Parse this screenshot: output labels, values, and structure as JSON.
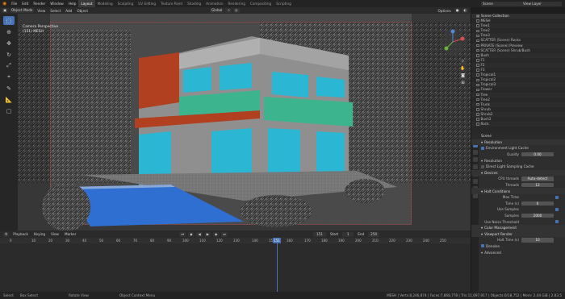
{
  "app": {
    "menus": [
      "File",
      "Edit",
      "Render",
      "Window",
      "Help"
    ],
    "workspaces": [
      "Layout",
      "Modeling",
      "Sculpting",
      "UV Editing",
      "Texture Paint",
      "Shading",
      "Animation",
      "Rendering",
      "Compositing",
      "Scripting"
    ],
    "active_workspace": "Layout",
    "scene": "Scene",
    "view_layer": "View Layer"
  },
  "viewport_header": {
    "mode": "Object Mode",
    "menus": [
      "View",
      "Select",
      "Add",
      "Object"
    ],
    "transform": "Global",
    "options": "Options"
  },
  "viewport": {
    "camera_label": "Camera Perspective",
    "object_label": "(151) MESH"
  },
  "timeline": {
    "menus": [
      "Playback",
      "Keying",
      "View",
      "Marker"
    ],
    "current_frame": "151",
    "start_label": "Start",
    "start": "1",
    "end_label": "End",
    "end": "250",
    "ruler": [
      "0",
      "10",
      "20",
      "30",
      "40",
      "50",
      "60",
      "70",
      "80",
      "90",
      "100",
      "110",
      "120",
      "130",
      "140",
      "150",
      "160",
      "170",
      "180",
      "190",
      "200",
      "210",
      "220",
      "230",
      "240",
      "250"
    ]
  },
  "outliner": {
    "title": "Scene Collection",
    "items": [
      "MESH",
      "Tree1",
      "Tree2",
      "Tree3",
      "SCATTER (Scene) Rocks",
      "PRIVATE (Scene) Preview",
      "SCATTER (Scene) Shrub/Bush",
      "Bush",
      "F1",
      "F2",
      "F3",
      "Tropical1",
      "Tropical2",
      "Tropical3",
      "Flower",
      "Tree",
      "Tree2",
      "Trunk",
      "Shrub",
      "Shrub2",
      "Bush2",
      "Rock"
    ]
  },
  "properties": {
    "header": "Scene",
    "rows": [
      {
        "type": "section",
        "label": "Resolution"
      },
      {
        "type": "check",
        "label": "Environment Light Cache",
        "on": true
      },
      {
        "type": "field",
        "label": "Quality",
        "value": "0.00"
      },
      {
        "type": "sub",
        "label": "Resolution"
      },
      {
        "type": "check",
        "label": "Direct Light Sampling Cache",
        "on": false
      },
      {
        "type": "section",
        "label": "Devices"
      },
      {
        "type": "field",
        "label": "CPU threads",
        "value": "Auto-detect"
      },
      {
        "type": "field",
        "label": "Threads",
        "value": "12"
      },
      {
        "type": "section",
        "label": "Halt Conditions"
      },
      {
        "type": "right",
        "label": "Max Time"
      },
      {
        "type": "field",
        "label": "Time (s)",
        "value": "0"
      },
      {
        "type": "right",
        "label": "Use Samples"
      },
      {
        "type": "field",
        "label": "Samples",
        "value": "2000"
      },
      {
        "type": "right",
        "label": "Use Noise Threshold"
      },
      {
        "type": "section",
        "label": "Color Management"
      },
      {
        "type": "section",
        "label": "Viewport Render"
      },
      {
        "type": "field",
        "label": "Halt Time (s)",
        "value": "10"
      },
      {
        "type": "check",
        "label": "Denoise",
        "on": true
      },
      {
        "type": "sub",
        "label": "Advanced"
      }
    ]
  },
  "status": {
    "items": [
      "Select",
      "Box Select",
      "Rotate View",
      "Object Context Menu"
    ],
    "stats": "MESH | Verts:8,246,874 | Faces:7,868,778 | Tris:11,697,917 | Objects:0/18,752 | Mem: 2.44 GiB | 2.83.5"
  },
  "colors": {
    "accent": "#4772b3",
    "glass": "#2bb6d4",
    "balcony": "#3cb58e",
    "rust": "#b0401f",
    "pool": "#2f6fd1"
  }
}
